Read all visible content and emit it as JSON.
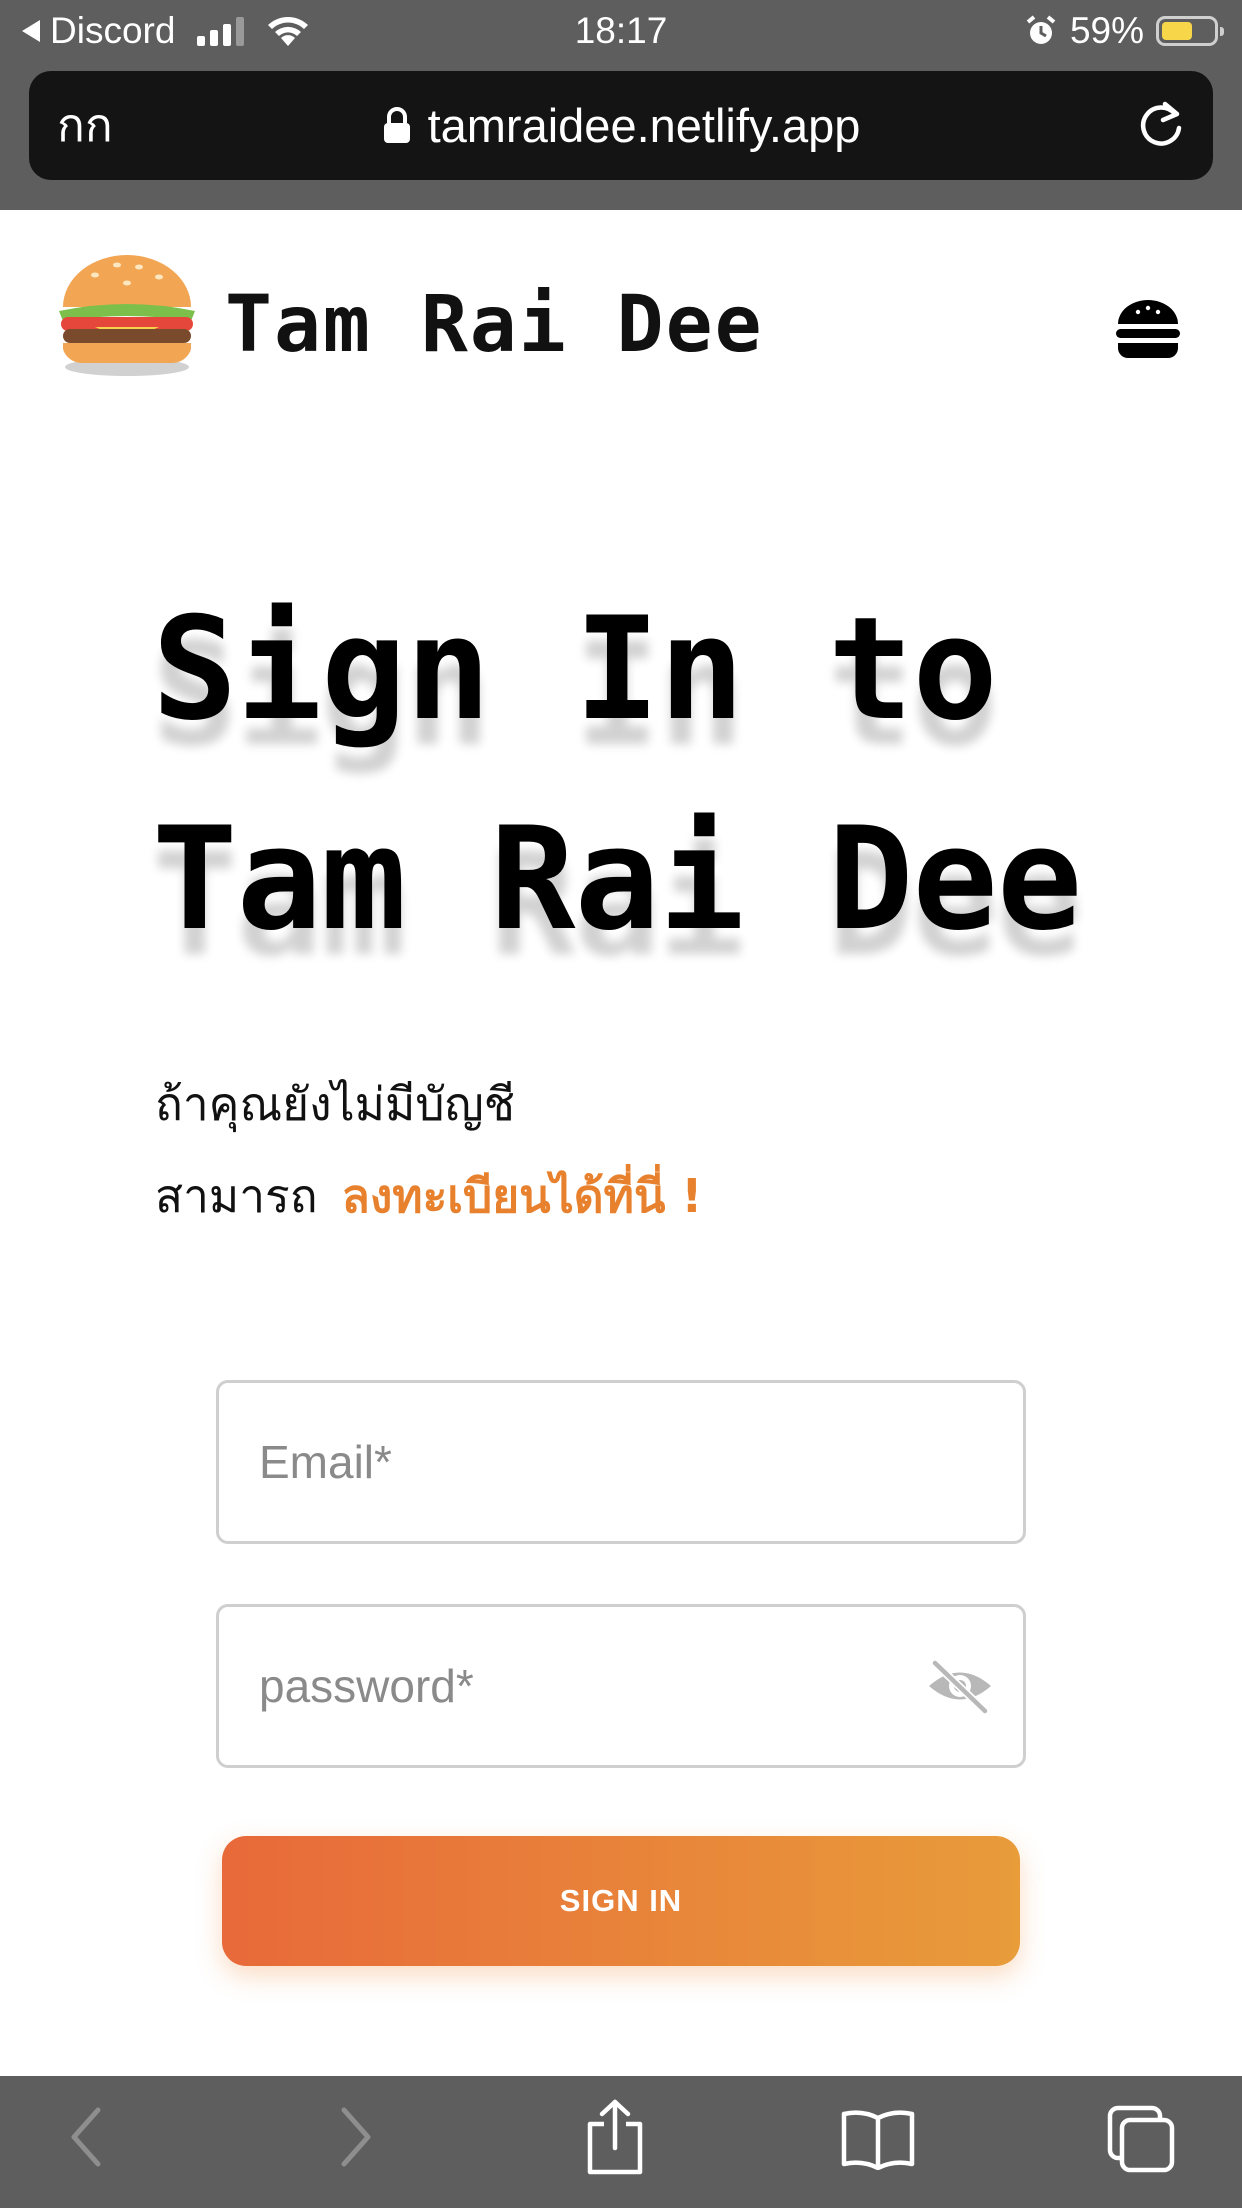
{
  "status_bar": {
    "back_app": "Discord",
    "time": "18:17",
    "battery": "59%",
    "battery_level": 0.59
  },
  "browser": {
    "text_size_button": "กก",
    "url": "tamraidee.netlify.app"
  },
  "site": {
    "title": "Tam Rai Dee",
    "logo": "burger-logo",
    "menu_icon": "burger-menu-icon"
  },
  "main": {
    "heading_line1": "Sign In to",
    "heading_line2": "Tam Rai Dee",
    "register_line1": "ถ้าคุณยังไม่มีบัญชี",
    "register_prefix": "สามารถ",
    "register_link": "ลงทะเบียนได้ที่นี่ !"
  },
  "form": {
    "email_placeholder": "Email*",
    "password_placeholder": "password*",
    "submit_label": "SIGN IN"
  },
  "colors": {
    "accent": "#e8812e",
    "button_gradient_start": "#e8693a",
    "button_gradient_end": "#e89c3a",
    "chrome_bg": "#5e5e5e"
  },
  "toolbar": {
    "icons": [
      "back-icon",
      "forward-icon",
      "share-icon",
      "bookmarks-icon",
      "tabs-icon"
    ]
  }
}
